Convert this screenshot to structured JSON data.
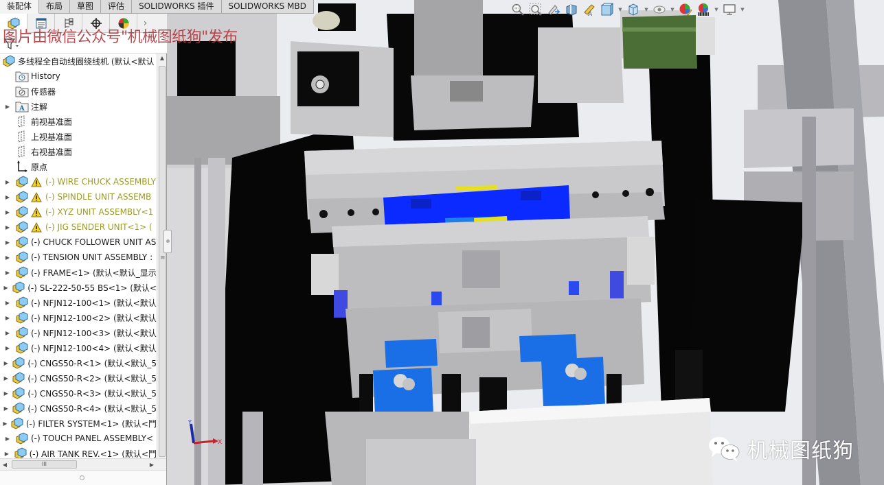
{
  "tabs": [
    {
      "label": "装配体",
      "active": true
    },
    {
      "label": "布局",
      "active": false
    },
    {
      "label": "草图",
      "active": false
    },
    {
      "label": "评估",
      "active": false
    },
    {
      "label": "SOLIDWORKS 插件",
      "active": false
    },
    {
      "label": "SOLIDWORKS MBD",
      "active": false
    }
  ],
  "panel": {
    "tabs": [
      {
        "name": "featuremanager-tab",
        "icon": "assembly-icon"
      },
      {
        "name": "propertymanager-tab",
        "icon": "property-list-icon"
      },
      {
        "name": "configurationmanager-tab",
        "icon": "configuration-icon"
      },
      {
        "name": "dimxpert-tab",
        "icon": "crosshair-icon"
      },
      {
        "name": "displaymanager-tab",
        "icon": "appearance-sphere-icon"
      }
    ],
    "more_glyph": "›"
  },
  "tree": {
    "root": "多线程全自动线圈绕线机  (默认<默认",
    "items": [
      {
        "label": "History",
        "icon": "history-folder-icon",
        "expandable": false,
        "warning": false
      },
      {
        "label": "传感器",
        "icon": "sensor-folder-icon",
        "expandable": false,
        "warning": false
      },
      {
        "label": "注解",
        "icon": "annotation-folder-icon",
        "expandable": true,
        "warning": false
      },
      {
        "label": "前视基准面",
        "icon": "plane-icon",
        "expandable": false,
        "warning": false
      },
      {
        "label": "上视基准面",
        "icon": "plane-icon",
        "expandable": false,
        "warning": false
      },
      {
        "label": "右视基准面",
        "icon": "plane-icon",
        "expandable": false,
        "warning": false
      },
      {
        "label": "原点",
        "icon": "origin-icon",
        "expandable": false,
        "warning": false
      },
      {
        "label": "(-) WIRE CHUCK ASSEMBLY",
        "icon": "subassembly-icon",
        "expandable": true,
        "warning": true
      },
      {
        "label": "(-) SPINDLE UNIT ASSEMB",
        "icon": "subassembly-icon",
        "expandable": true,
        "warning": true
      },
      {
        "label": "(-) XYZ  UNIT ASSEMBLY<1",
        "icon": "subassembly-icon",
        "expandable": true,
        "warning": true
      },
      {
        "label": "(-) JIG SENDER UNIT<1> (",
        "icon": "subassembly-icon",
        "expandable": true,
        "warning": true
      },
      {
        "label": "(-) CHUCK FOLLOWER UNIT AS",
        "icon": "subassembly-icon",
        "expandable": true,
        "warning": false
      },
      {
        "label": "(-) TENSION UNIT ASSEMBLY :",
        "icon": "subassembly-icon",
        "expandable": true,
        "warning": false
      },
      {
        "label": "(-) FRAME<1> (默认<默认_显示",
        "icon": "subassembly-icon",
        "expandable": true,
        "warning": false
      },
      {
        "label": "(-) SL-222-50-55 BS<1> (默认<",
        "icon": "subassembly-icon",
        "expandable": true,
        "warning": false
      },
      {
        "label": "(-) NFJN12-100<1> (默认<默认",
        "icon": "subassembly-icon",
        "expandable": true,
        "warning": false
      },
      {
        "label": "(-) NFJN12-100<2> (默认<默认",
        "icon": "subassembly-icon",
        "expandable": true,
        "warning": false
      },
      {
        "label": "(-) NFJN12-100<3> (默认<默认",
        "icon": "subassembly-icon",
        "expandable": true,
        "warning": false
      },
      {
        "label": "(-) NFJN12-100<4> (默认<默认",
        "icon": "subassembly-icon",
        "expandable": true,
        "warning": false
      },
      {
        "label": "(-) CNGS50-R<1> (默认<默认_5",
        "icon": "subassembly-icon",
        "expandable": true,
        "warning": false
      },
      {
        "label": "(-) CNGS50-R<2> (默认<默认_5",
        "icon": "subassembly-icon",
        "expandable": true,
        "warning": false
      },
      {
        "label": "(-) CNGS50-R<3> (默认<默认_5",
        "icon": "subassembly-icon",
        "expandable": true,
        "warning": false
      },
      {
        "label": "(-) CNGS50-R<4> (默认<默认_5",
        "icon": "subassembly-icon",
        "expandable": true,
        "warning": false
      },
      {
        "label": "(-) FILTER SYSTEM<1> (默认<鬥",
        "icon": "subassembly-icon",
        "expandable": true,
        "warning": false
      },
      {
        "label": "(-) TOUCH PANEL ASSEMBLY<",
        "icon": "subassembly-icon",
        "expandable": true,
        "warning": false
      },
      {
        "label": "(-) AIR TANK REV.<1> (默认<鬥",
        "icon": "subassembly-icon",
        "expandable": true,
        "warning": false
      }
    ]
  },
  "scroll": {
    "vertical_up": "▲",
    "vertical_down": "▼",
    "horizontal_left": "◀",
    "horizontal_right": "▶",
    "grip": "III"
  },
  "hud": {
    "buttons": [
      "zoom-to-fit-icon",
      "zoom-to-area-icon",
      "previous-view-icon",
      "section-view-icon",
      "dynamic-annotation-icon",
      "view-orientation-icon",
      "display-style-icon",
      "hide-show-items-icon",
      "edit-appearance-icon",
      "apply-scene-icon",
      "view-settings-icon"
    ]
  },
  "triad": {
    "x_label": "X",
    "y_label": "Y"
  },
  "watermarks": {
    "top": "图片由微信公众号\"机械图纸狗\"发布",
    "bottom": "机械图纸狗"
  },
  "colors": {
    "warning_text": "#9a9a2a",
    "watermark_red": "#b0343a",
    "part_blue": "#0a2aff",
    "part_light_blue": "#1e7fe6",
    "part_yellow": "#e6e020",
    "frame_black": "#050505",
    "part_grey": "#c5c5c7",
    "motor_green": "#4a6e35"
  }
}
